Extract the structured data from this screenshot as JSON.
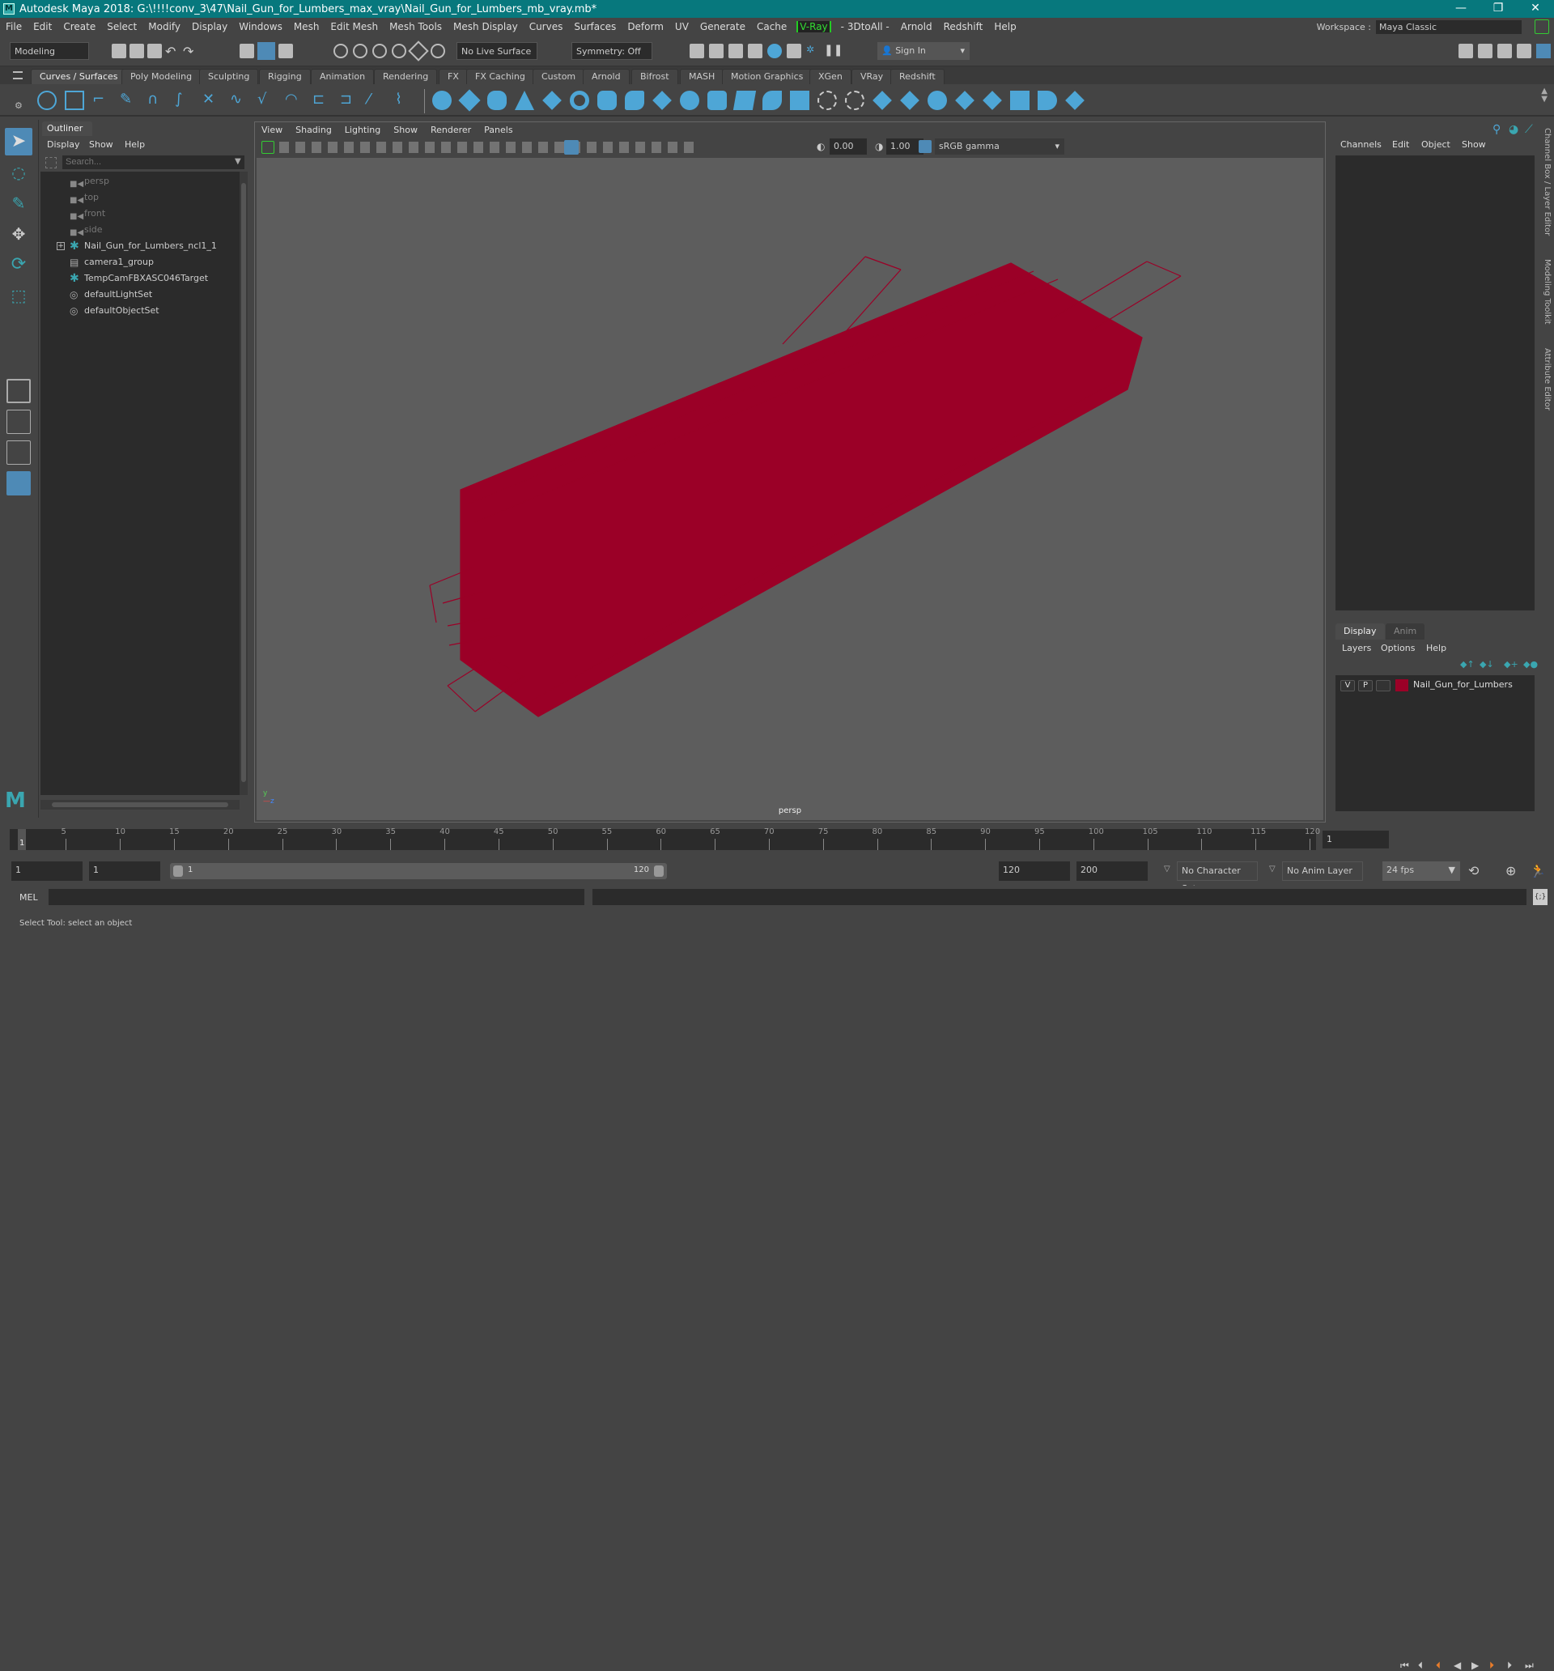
{
  "window": {
    "title": "Autodesk Maya 2018: G:\\!!!!conv_3\\47\\Nail_Gun_for_Lumbers_max_vray\\Nail_Gun_for_Lumbers_mb_vray.mb*",
    "minimize": "—",
    "maximize": "❐",
    "close": "✕"
  },
  "menubar": {
    "items": [
      "File",
      "Edit",
      "Create",
      "Select",
      "Modify",
      "Display",
      "Windows",
      "Mesh",
      "Edit Mesh",
      "Mesh Tools",
      "Mesh Display",
      "Curves",
      "Surfaces",
      "Deform",
      "UV",
      "Generate",
      "Cache",
      "V-Ray",
      "- 3DtoAll -",
      "Arnold",
      "Redshift",
      "Help"
    ],
    "workspace_label": "Workspace :",
    "workspace_value": "Maya Classic"
  },
  "statusline": {
    "mode": "Modeling",
    "live_surface": "No Live Surface",
    "symmetry": "Symmetry: Off",
    "sign_in": "Sign In"
  },
  "shelf": {
    "tabs": [
      "Curves / Surfaces",
      "Poly Modeling",
      "Sculpting",
      "Rigging",
      "Animation",
      "Rendering",
      "FX",
      "FX Caching",
      "Custom",
      "Arnold",
      "Bifrost",
      "MASH",
      "Motion Graphics",
      "XGen",
      "VRay",
      "Redshift"
    ],
    "active_tab": "Curves / Surfaces",
    "accent_color": "#4ea6d6"
  },
  "outliner": {
    "title": "Outliner",
    "menu": [
      "Display",
      "Show",
      "Help"
    ],
    "search_placeholder": "Search...",
    "items": [
      {
        "label": "persp",
        "icon": "camera-icon",
        "dim": true
      },
      {
        "label": "top",
        "icon": "camera-icon",
        "dim": true
      },
      {
        "label": "front",
        "icon": "camera-icon",
        "dim": true
      },
      {
        "label": "side",
        "icon": "camera-icon",
        "dim": true
      },
      {
        "label": "Nail_Gun_for_Lumbers_ncl1_1",
        "icon": "transform-icon",
        "dim": false,
        "expandable": true
      },
      {
        "label": "camera1_group",
        "icon": "group-icon",
        "dim": false
      },
      {
        "label": "TempCamFBXASC046Target",
        "icon": "transform-icon",
        "dim": false
      },
      {
        "label": "defaultLightSet",
        "icon": "set-icon",
        "dim": false
      },
      {
        "label": "defaultObjectSet",
        "icon": "set-icon",
        "dim": false
      }
    ]
  },
  "viewport": {
    "menu": [
      "View",
      "Shading",
      "Lighting",
      "Show",
      "Renderer",
      "Panels"
    ],
    "exposure": "0.00",
    "gamma": "1.00",
    "color_space": "sRGB gamma",
    "camera_label": "persp",
    "wire_color": "#9b0027"
  },
  "channelbox": {
    "menu": [
      "Channels",
      "Edit",
      "Object",
      "Show"
    ]
  },
  "side_tabs": [
    "Channel Box / Layer Editor",
    "Modeling Toolkit",
    "Attribute Editor"
  ],
  "layers": {
    "tabs": [
      "Display",
      "Anim"
    ],
    "active_tab": "Display",
    "menu": [
      "Layers",
      "Options",
      "Help"
    ],
    "rows": [
      {
        "v": "V",
        "p": "P",
        "name": "Nail_Gun_for_Lumbers",
        "color": "#9b0027"
      }
    ]
  },
  "timeline": {
    "ticks": [
      "5",
      "10",
      "15",
      "20",
      "25",
      "30",
      "35",
      "40",
      "45",
      "50",
      "55",
      "60",
      "65",
      "70",
      "75",
      "80",
      "85",
      "90",
      "95",
      "100",
      "105",
      "110",
      "115",
      "120"
    ],
    "current_frame_marker": "1",
    "current_frame": "1"
  },
  "range": {
    "start": "1",
    "playback_start": "1",
    "slider_start": "1",
    "slider_end": "120",
    "playback_end": "120",
    "end": "200",
    "character_set": "No Character Set",
    "anim_layer": "No Anim Layer",
    "fps": "24 fps"
  },
  "cmdline": {
    "language": "MEL"
  },
  "helpline": {
    "text": "Select Tool: select an object"
  }
}
